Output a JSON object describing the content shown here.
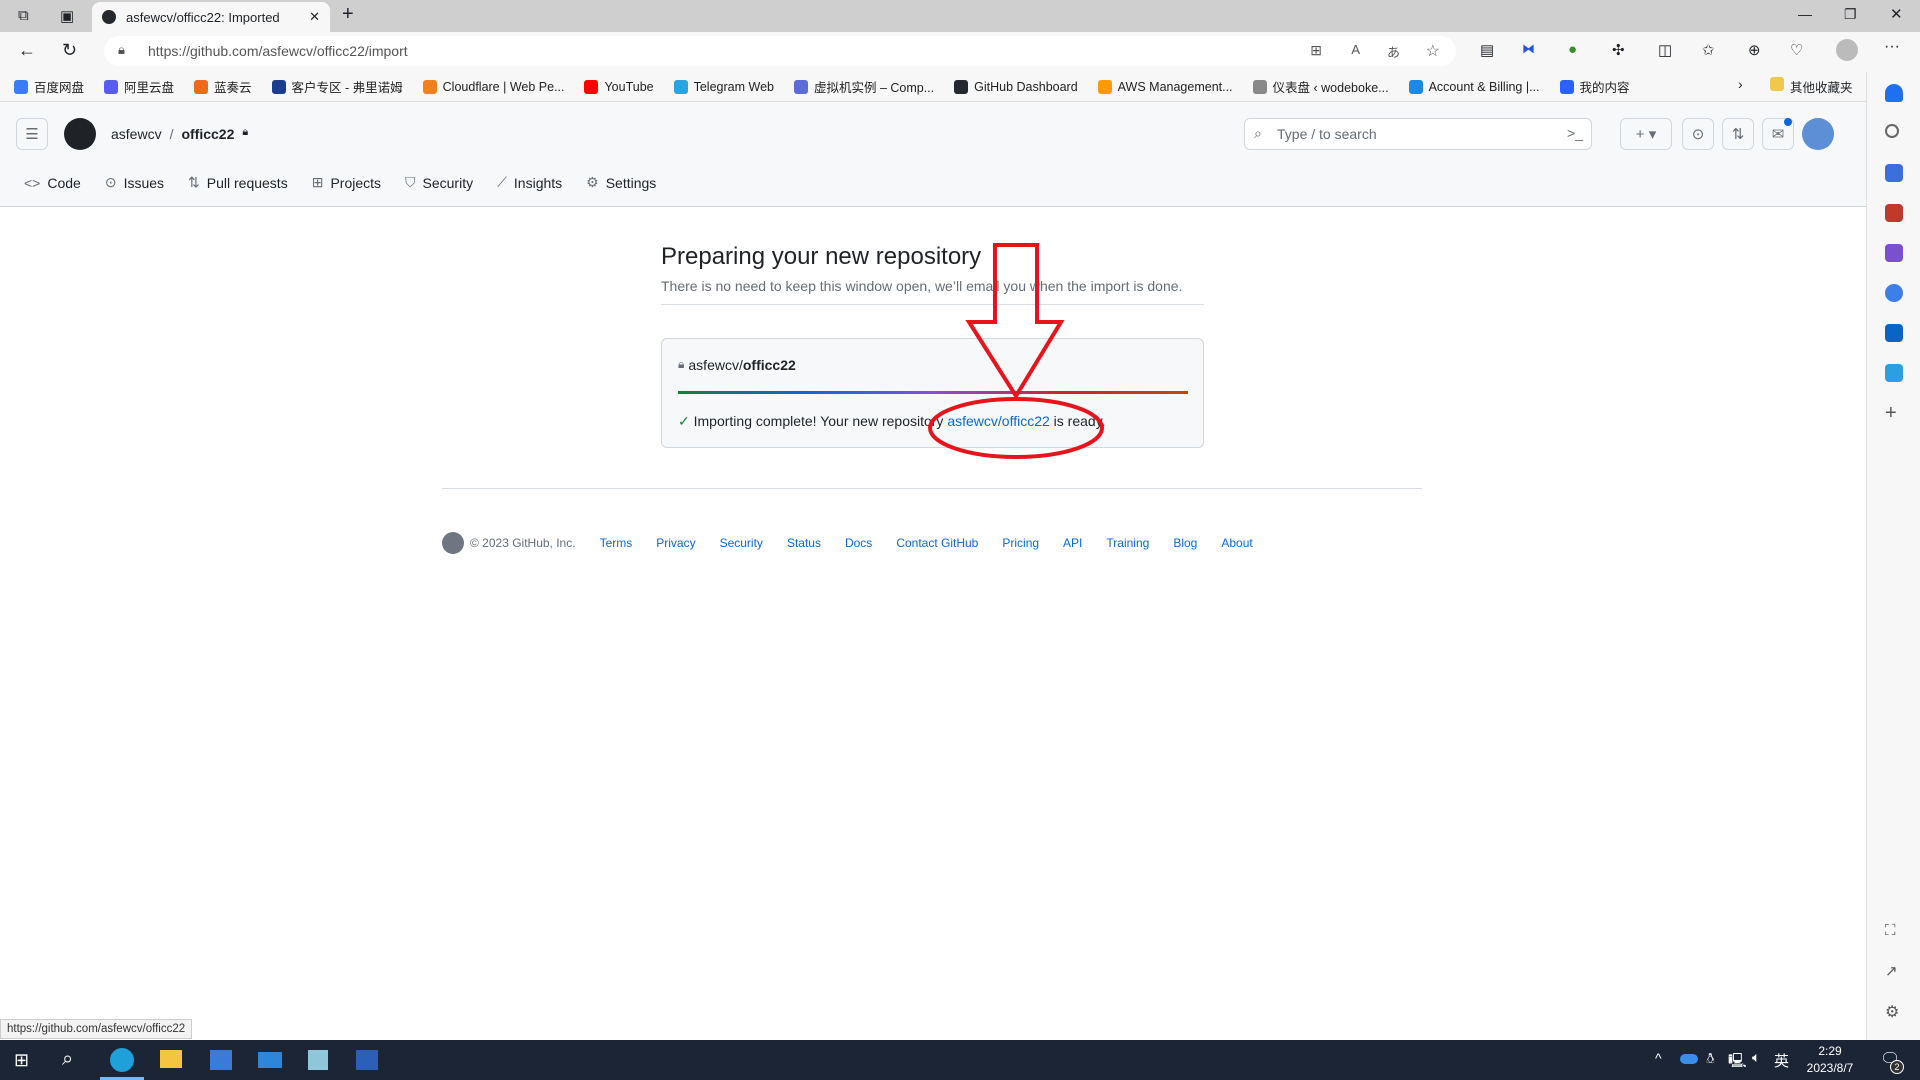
{
  "browser": {
    "tab_title": "asfewcv/officc22: Imported",
    "url": "https://github.com/asfewcv/officc22/import",
    "bookmarks": [
      {
        "label": "百度网盘",
        "color": "#3b7cf5"
      },
      {
        "label": "阿里云盘",
        "color": "#5a5cf0"
      },
      {
        "label": "蓝奏云",
        "color": "#f06a1d"
      },
      {
        "label": "客户专区 - 弗里诺姆",
        "color": "#1a3d8f"
      },
      {
        "label": "Cloudflare | Web Pe...",
        "color": "#f38020"
      },
      {
        "label": "YouTube",
        "color": "#ff0000"
      },
      {
        "label": "Telegram Web",
        "color": "#2aa3e0"
      },
      {
        "label": "虚拟机实例 – Comp...",
        "color": "#5b6bd8"
      },
      {
        "label": "GitHub Dashboard",
        "color": "#24292f"
      },
      {
        "label": "AWS Management...",
        "color": "#ff9900"
      },
      {
        "label": "仪表盘 ‹ wodeboke...",
        "color": "#888888"
      },
      {
        "label": "Account & Billing |...",
        "color": "#1e88e5"
      },
      {
        "label": "我的内容",
        "color": "#2962ff"
      }
    ],
    "other_bookmarks": "其他收藏夹",
    "status_url": "https://github.com/asfewcv/officc22"
  },
  "header": {
    "owner": "asfewcv",
    "separator": "/",
    "repo": "officc22",
    "search_placeholder": "Type / to search",
    "nav": [
      "Code",
      "Issues",
      "Pull requests",
      "Projects",
      "Security",
      "Insights",
      "Settings"
    ]
  },
  "main": {
    "title": "Preparing your new repository",
    "subtitle": "There is no need to keep this window open, we’ll email you when the import is done.",
    "repo_owner": "asfewcv/",
    "repo_name": "officc22",
    "progress_percent": 100,
    "msg_prefix": "Importing complete! Your new repository ",
    "msg_link": "asfewcv/officc22",
    "msg_suffix": " is ready."
  },
  "footer": {
    "copyright": "© 2023 GitHub, Inc.",
    "links": [
      "Terms",
      "Privacy",
      "Security",
      "Status",
      "Docs",
      "Contact GitHub",
      "Pricing",
      "API",
      "Training",
      "Blog",
      "About"
    ]
  },
  "taskbar": {
    "time": "2:29",
    "date": "2023/8/7",
    "ime": "英",
    "notifications": "2"
  },
  "annotation_color": "#e8141c"
}
